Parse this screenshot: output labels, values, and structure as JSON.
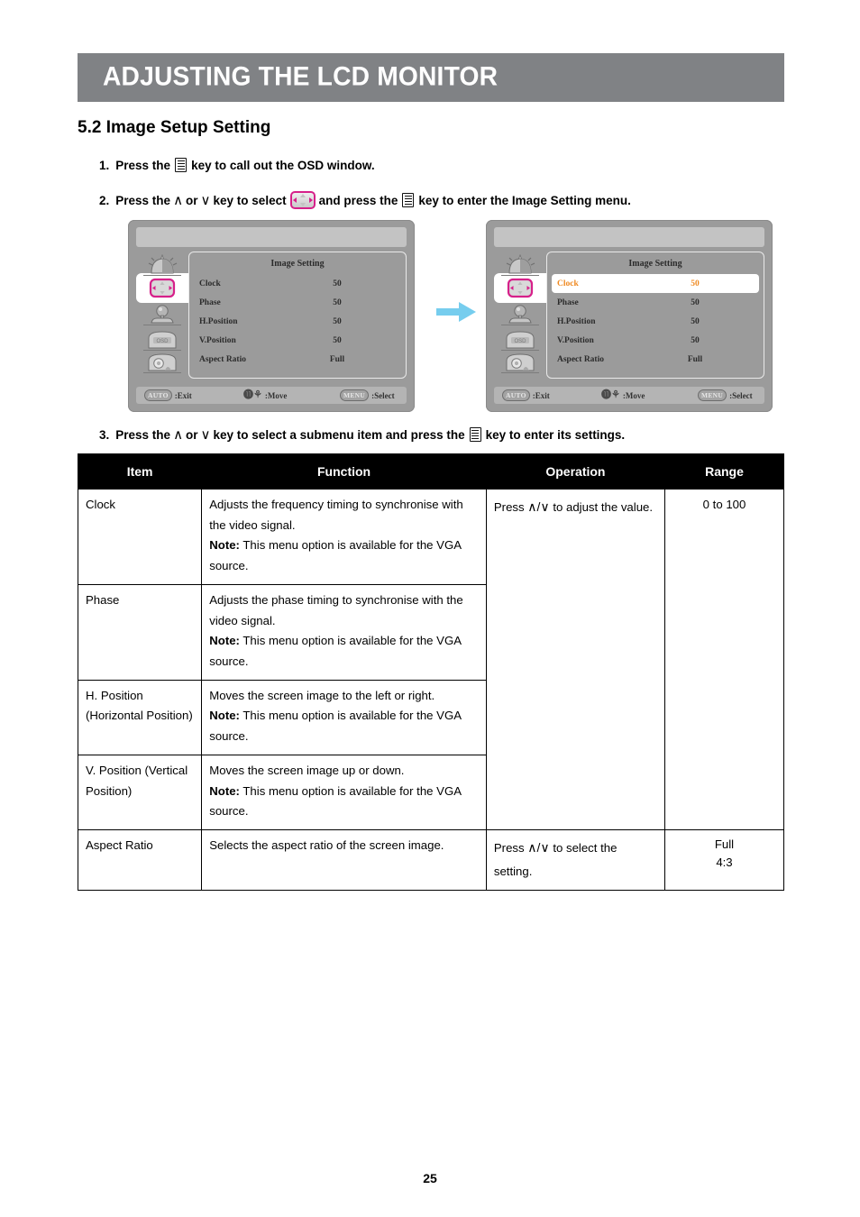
{
  "header": {
    "title": "ADJUSTING THE LCD MONITOR"
  },
  "section": {
    "heading": "5.2 Image Setup Setting"
  },
  "steps": [
    {
      "num": "1.",
      "before": "Press the",
      "icon": "menu-key-icon",
      "after": "key to call out the OSD window."
    },
    {
      "num": "2.",
      "part1": "Press the",
      "up": "∧",
      "or": "or",
      "down": "∨",
      "part2": "key to select",
      "icon": "dpad-icon",
      "part3": "and press the",
      "icon2": "menu-key-icon",
      "part4": "key to enter the Image Setting menu."
    },
    {
      "num": "3.",
      "part1": "Press the",
      "up": "∧",
      "or": "or",
      "down": "∨",
      "part2": "key to select a submenu item and press the",
      "icon": "menu-key-icon",
      "part3": "key to enter its settings."
    }
  ],
  "osd": {
    "title": "Image Setting",
    "sidebar_icons": [
      "picture-icon",
      "image-setup-dpad-icon",
      "display-setup-icon",
      "osd-setup-icon",
      "system-setup-icon"
    ],
    "selected_sidebar_index": 1,
    "rows": [
      {
        "label": "Clock",
        "value": "50"
      },
      {
        "label": "Phase",
        "value": "50"
      },
      {
        "label": "H.Position",
        "value": "50"
      },
      {
        "label": "V.Position",
        "value": "50"
      },
      {
        "label": "Aspect Ratio",
        "value": "Full"
      }
    ],
    "footer": {
      "exit_key": "AUTO",
      "exit_label": ":Exit",
      "move_label": ":Move",
      "select_key": "MENU",
      "select_label": ":Select"
    },
    "left_panel": {
      "selected_row_index": -1
    },
    "right_panel": {
      "selected_row_index": 0
    },
    "flow_arrow": "right-arrow-icon",
    "accent_orange": "#ef8a22",
    "accent_pink": "#d6218a",
    "arrow_blue": "#76cdee",
    "panel_gray": "#9b9b9b"
  },
  "table": {
    "headers": [
      "Item",
      "Function",
      "Operation",
      "Range"
    ],
    "rows": [
      {
        "item": "Clock",
        "function_lines": [
          "Adjusts the frequency timing to synchronise with the video signal."
        ],
        "note_label": "Note:",
        "note_text": "This menu option is available for the VGA source."
      },
      {
        "item": "Phase",
        "function_lines": [
          "Adjusts the phase timing to synchronise with the video signal."
        ],
        "note_label": "Note:",
        "note_text": "This menu option is available for the VGA source."
      },
      {
        "item": "H. Position (Horizontal Position)",
        "function_lines": [
          "Moves the screen image to the left or right."
        ],
        "note_label": "Note:",
        "note_text": "This menu option is available for the VGA source."
      },
      {
        "item": "V. Position (Vertical Position)",
        "function_lines": [
          "Moves the screen image up or down."
        ],
        "note_label": "Note:",
        "note_text": "This menu option is available for the VGA source."
      },
      {
        "item": "Aspect Ratio",
        "function_lines": [
          "Selects the aspect ratio of the screen image."
        ],
        "note_label": "",
        "note_text": ""
      }
    ],
    "operation_adjust": {
      "pre": "Press",
      "keys": "∧/∨",
      "post": "to adjust the value."
    },
    "operation_select": {
      "pre": "Press",
      "keys": "∧/∨",
      "post": "to select the setting."
    },
    "range_adjust": "0 to 100",
    "range_select": [
      "Full",
      "4:3"
    ]
  },
  "footer": {
    "page_number": "25"
  }
}
